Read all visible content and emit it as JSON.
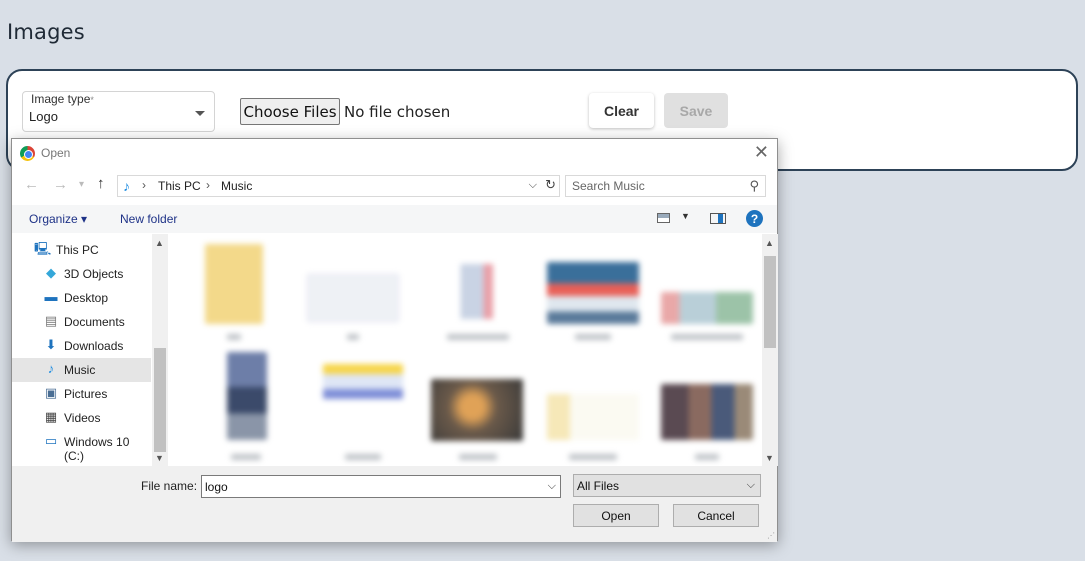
{
  "page": {
    "title": "Images"
  },
  "form": {
    "image_type_label": "Image type",
    "image_type_required": "*",
    "image_type_value": "Logo",
    "choose_files_label": "Choose Files",
    "file_status": "No file chosen",
    "clear_label": "Clear",
    "save_label": "Save"
  },
  "dialog": {
    "title": "Open",
    "close_symbol": "✕",
    "breadcrumb": [
      "This PC",
      "Music"
    ],
    "search_placeholder": "Search Music",
    "toolbar": {
      "organize": "Organize ▾",
      "new_folder": "New folder"
    },
    "nav_items": [
      {
        "label": "This PC",
        "icon": "computer-icon"
      },
      {
        "label": "3D Objects",
        "icon": "cube-icon"
      },
      {
        "label": "Desktop",
        "icon": "desktop-icon"
      },
      {
        "label": "Documents",
        "icon": "document-icon"
      },
      {
        "label": "Downloads",
        "icon": "download-icon"
      },
      {
        "label": "Music",
        "icon": "music-note-icon",
        "selected": true
      },
      {
        "label": "Pictures",
        "icon": "picture-icon"
      },
      {
        "label": "Videos",
        "icon": "film-icon"
      },
      {
        "label": "Windows 10 (C:)",
        "icon": "drive-icon"
      }
    ],
    "file_name_label": "File name:",
    "file_name_value": "logo",
    "file_type_value": "All Files",
    "open_label": "Open",
    "cancel_label": "Cancel"
  },
  "colors": {
    "background": "#d9dfe7",
    "card_border": "#2d4257",
    "link_blue": "#1e3287",
    "accent_blue": "#1e73be"
  }
}
